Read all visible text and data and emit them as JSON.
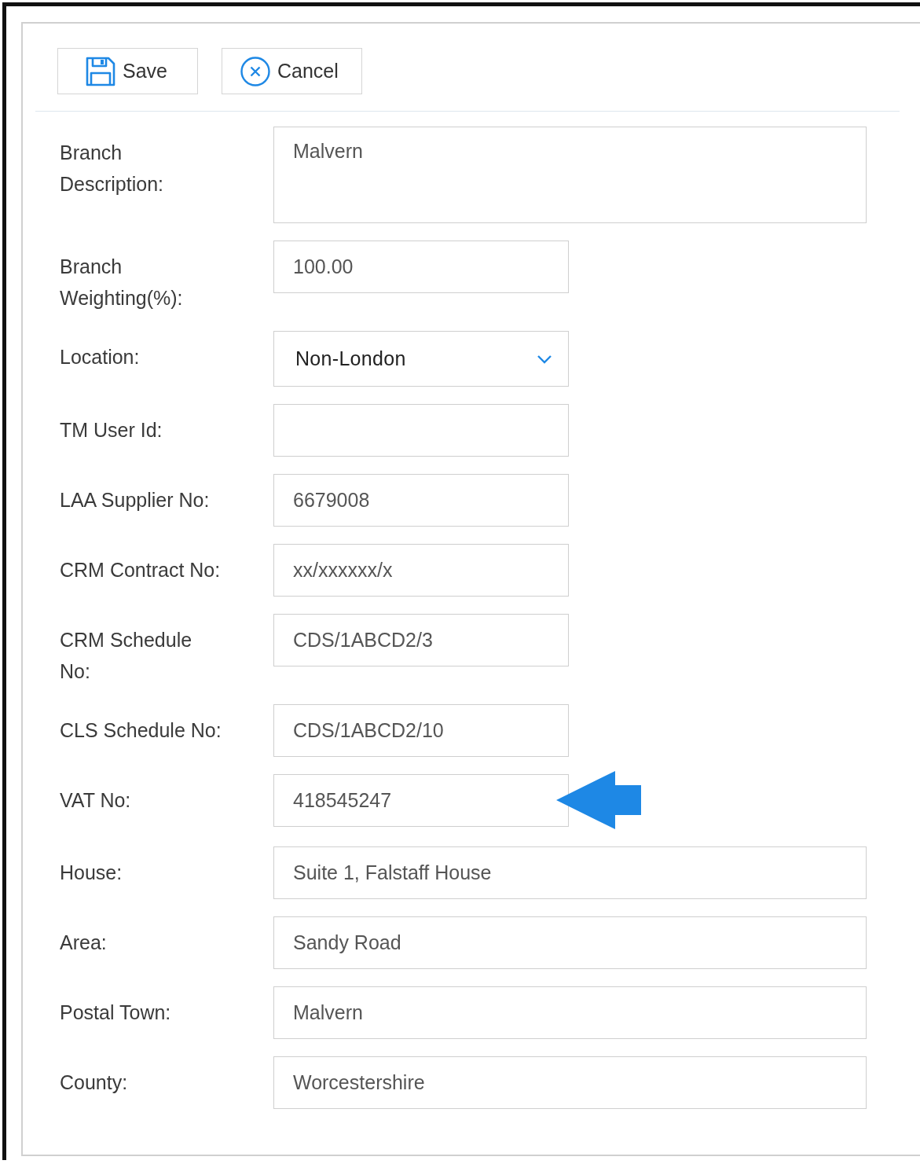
{
  "toolbar": [
    {
      "kind": "save",
      "label": "Save"
    },
    {
      "kind": "cancel",
      "label": "Cancel"
    }
  ],
  "fields": [
    {
      "label": "Branch Description:",
      "kind": "textarea",
      "value": "Malvern",
      "pointer_arrow": false
    },
    {
      "label": "Branch Weighting(%):",
      "kind": "short",
      "value": "100.00",
      "pointer_arrow": false
    },
    {
      "label": "Location:",
      "kind": "select",
      "value": "Non-London",
      "pointer_arrow": false
    },
    {
      "label": "TM User Id:",
      "kind": "short",
      "pointer_arrow": false
    },
    {
      "label": "LAA Supplier No:",
      "kind": "short",
      "value": "6679008",
      "pointer_arrow": false
    },
    {
      "label": "CRM Contract No:",
      "kind": "short",
      "value": "xx/xxxxxx/x",
      "pointer_arrow": false
    },
    {
      "label": "CRM Schedule No:",
      "kind": "short",
      "value": "CDS/1ABCD2/3",
      "pointer_arrow": false
    },
    {
      "label": "CLS Schedule No:",
      "kind": "short",
      "value": "CDS/1ABCD2/10",
      "pointer_arrow": false
    },
    {
      "label": "VAT No:",
      "kind": "short",
      "value": "418545247",
      "pointer_arrow": true
    },
    {
      "label": "House:",
      "kind": "long",
      "value": "Suite 1, Falstaff House",
      "pointer_arrow": false
    },
    {
      "label": "Area:",
      "kind": "long",
      "value": "Sandy Road",
      "pointer_arrow": false
    },
    {
      "label": "Postal Town:",
      "kind": "long",
      "value": "Malvern",
      "pointer_arrow": false
    },
    {
      "label": "County:",
      "kind": "long",
      "value": "Worcestershire",
      "pointer_arrow": false
    }
  ]
}
